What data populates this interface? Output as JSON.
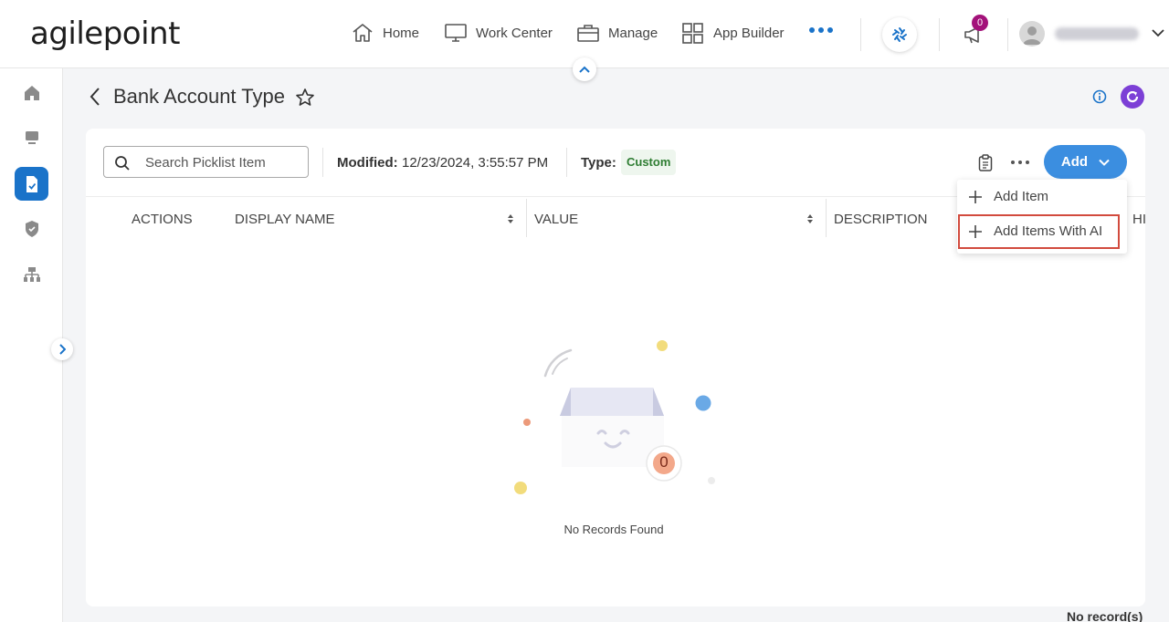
{
  "header": {
    "logo": "agilepoint",
    "nav": [
      {
        "label": "Home",
        "icon": "home-icon"
      },
      {
        "label": "Work Center",
        "icon": "monitor-icon"
      },
      {
        "label": "Manage",
        "icon": "briefcase-icon"
      },
      {
        "label": "App Builder",
        "icon": "grid-icon"
      }
    ],
    "notification_count": "0"
  },
  "sidebar": {
    "items": [
      {
        "icon": "home-icon"
      },
      {
        "icon": "monitor-icon"
      },
      {
        "icon": "document-check-icon",
        "active": true
      },
      {
        "icon": "shield-icon"
      },
      {
        "icon": "org-chart-icon"
      }
    ]
  },
  "page": {
    "title": "Bank Account Type"
  },
  "toolbar": {
    "search_placeholder": "Search Picklist Item",
    "modified_label": "Modified:",
    "modified_value": "12/23/2024, 3:55:57 PM",
    "type_label": "Type:",
    "type_value": "Custom",
    "add_label": "Add"
  },
  "dropdown": {
    "items": [
      "Add Item",
      "Add Items With AI"
    ]
  },
  "table": {
    "columns": [
      "ACTIONS",
      "DISPLAY NAME",
      "VALUE",
      "DESCRIPTION",
      "HI"
    ]
  },
  "empty_state": {
    "count": "0",
    "message": "No Records Found"
  },
  "footer": {
    "records": "No record(s)"
  },
  "colors": {
    "primary": "#1a73c9",
    "add_button": "#3b8ee0",
    "badge": "#a3127a",
    "highlight": "#d24b3e",
    "type_green": "#2e7d32"
  }
}
